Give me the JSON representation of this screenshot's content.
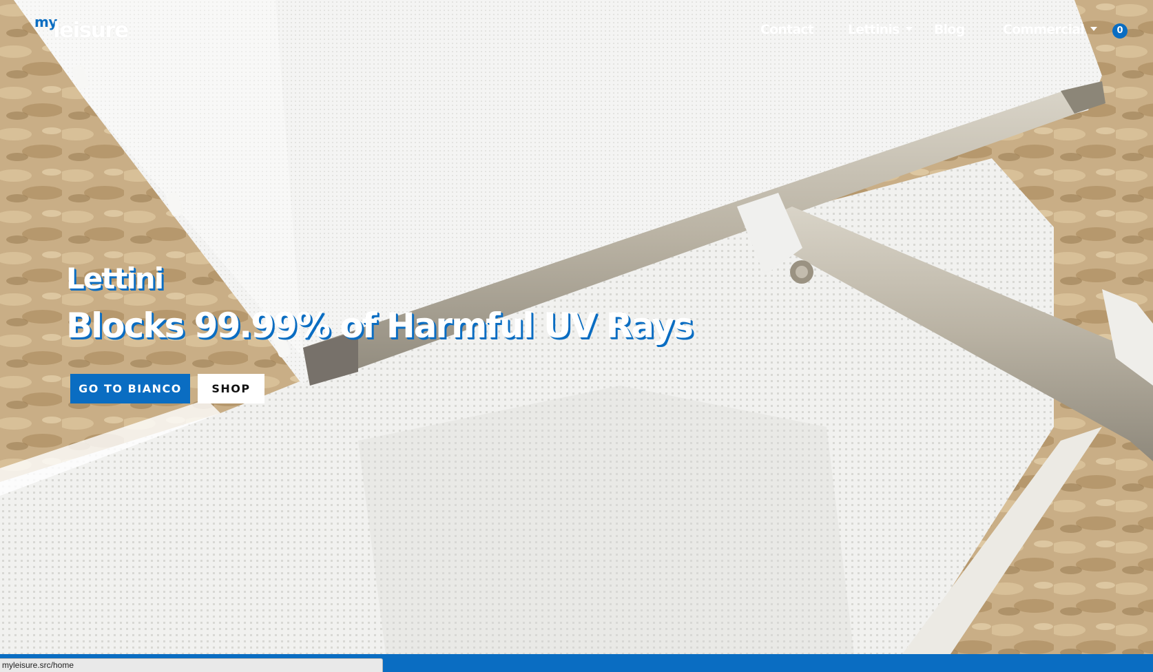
{
  "brand": {
    "logo_prefix": "my",
    "logo_main": "leisure"
  },
  "nav": {
    "items": [
      {
        "label": "Contact",
        "has_dropdown": false
      },
      {
        "label": "Lettinis",
        "has_dropdown": true
      },
      {
        "label": "Blog",
        "has_dropdown": false
      },
      {
        "label": "Commercial",
        "has_dropdown": true
      }
    ],
    "cart_count": "0"
  },
  "hero": {
    "subtitle": "Lettini",
    "title": "Blocks 99.99% of Harmful UV Rays",
    "primary_button": "GO TO BIANCO",
    "secondary_button": "SHOP"
  },
  "status_bar": {
    "url": "myleisure.src/home"
  },
  "colors": {
    "accent": "#0a6dc2",
    "sand": "#c9b08a",
    "fabric": "#f3f3f1",
    "frame": "#c8c2b4"
  }
}
